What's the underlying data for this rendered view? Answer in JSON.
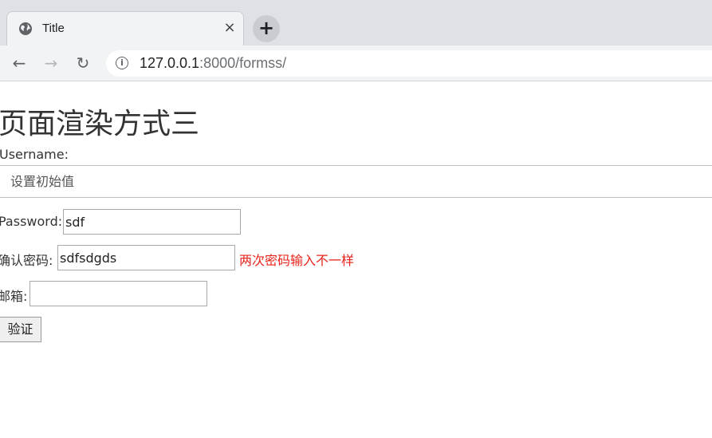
{
  "browser": {
    "tab_title": "Title",
    "tab_close": "×",
    "new_tab": "+",
    "url_host": "127.0.0.1",
    "url_rest": ":8000/formss/",
    "back": "←",
    "forward": "→",
    "reload": "↻",
    "info": "i"
  },
  "page": {
    "title": "页面渲染方式三",
    "username_label": "Username:",
    "username_placeholder": "设置初始值",
    "password_label": "Password:",
    "password_value": "sdf",
    "confirm_label": "确认密码:",
    "confirm_value": "sdfsdgds",
    "confirm_error": "两次密码输入不一样",
    "email_label": "邮箱:",
    "email_value": "",
    "submit_label": "验证"
  },
  "colors": {
    "error": "#e8231b",
    "chrome_bg": "#dee1e6"
  }
}
